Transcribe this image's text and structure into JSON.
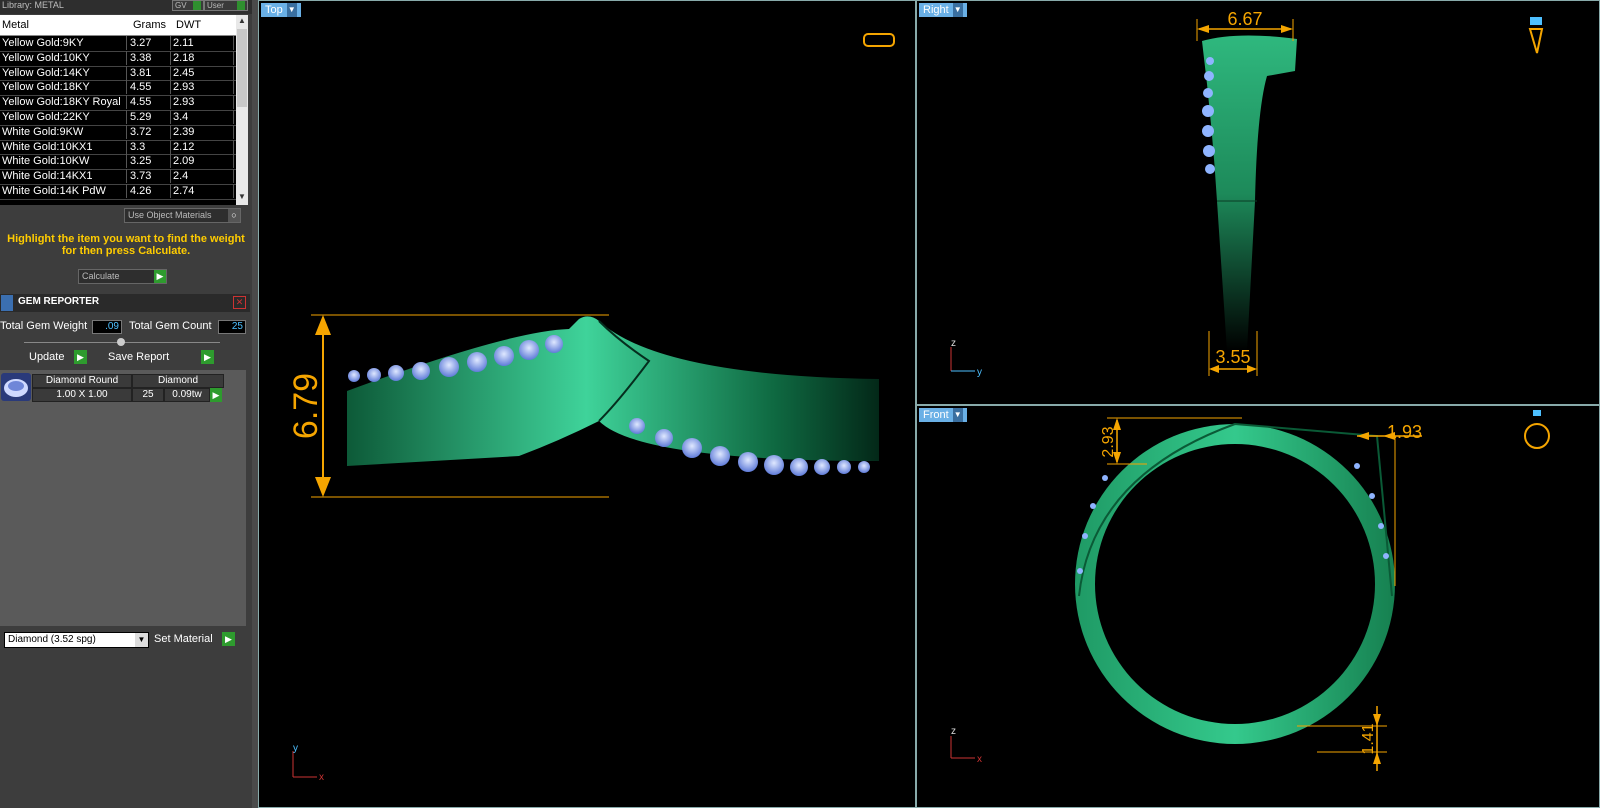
{
  "library": {
    "title": "Library: METAL",
    "gv_button": "GV",
    "user_button": "User",
    "columns": [
      "Metal",
      "Grams",
      "DWT"
    ],
    "rows": [
      [
        "Yellow Gold:9KY",
        "3.27",
        "2.11"
      ],
      [
        "Yellow Gold:10KY",
        "3.38",
        "2.18"
      ],
      [
        "Yellow Gold:14KY",
        "3.81",
        "2.45"
      ],
      [
        "Yellow Gold:18KY",
        "4.55",
        "2.93"
      ],
      [
        "Yellow Gold:18KY Royal",
        "4.55",
        "2.93"
      ],
      [
        "Yellow Gold:22KY",
        "5.29",
        "3.4"
      ],
      [
        "White Gold:9KW",
        "3.72",
        "2.39"
      ],
      [
        "White Gold:10KX1",
        "3.3",
        "2.12"
      ],
      [
        "White Gold:10KW",
        "3.25",
        "2.09"
      ],
      [
        "White Gold:14KX1",
        "3.73",
        "2.4"
      ],
      [
        "White Gold:14K PdW",
        "4.26",
        "2.74"
      ]
    ],
    "use_object_materials": "Use Object Materials",
    "hint": "Highlight the item you want to find the weight for then press Calculate.",
    "calculate_button": "Calculate"
  },
  "gem_reporter": {
    "title": "GEM REPORTER",
    "total_weight_label": "Total Gem Weight",
    "total_weight_value": ".09",
    "total_count_label": "Total Gem Count",
    "total_count_value": "25",
    "update_button": "Update",
    "save_report_button": "Save Report",
    "gems": [
      {
        "shape": "Diamond Round",
        "material": "Diamond",
        "size": "1.00 X 1.00",
        "count": "25",
        "weight": "0.09tw"
      }
    ],
    "material_select": "Diamond    (3.52 spg)",
    "set_material_button": "Set Material"
  },
  "viewports": {
    "top": {
      "label": "Top",
      "dimension": "6.79",
      "axis_v": "y",
      "axis_h": "x"
    },
    "right": {
      "label": "Right",
      "dimension_top": "6.67",
      "dimension_bottom": "3.55",
      "axis_v": "z",
      "axis_h": "y"
    },
    "front": {
      "label": "Front",
      "dimension_left": "2.93",
      "dimension_right": "1.93",
      "dimension_bottom": "1.41",
      "axis_v": "z",
      "axis_h": "x"
    }
  },
  "colors": {
    "metal_green": "#1e8a5a",
    "gem_blue": "#8fb4ff",
    "dimension_orange": "#f5a500",
    "viewport_label": "#6ab0e6"
  }
}
